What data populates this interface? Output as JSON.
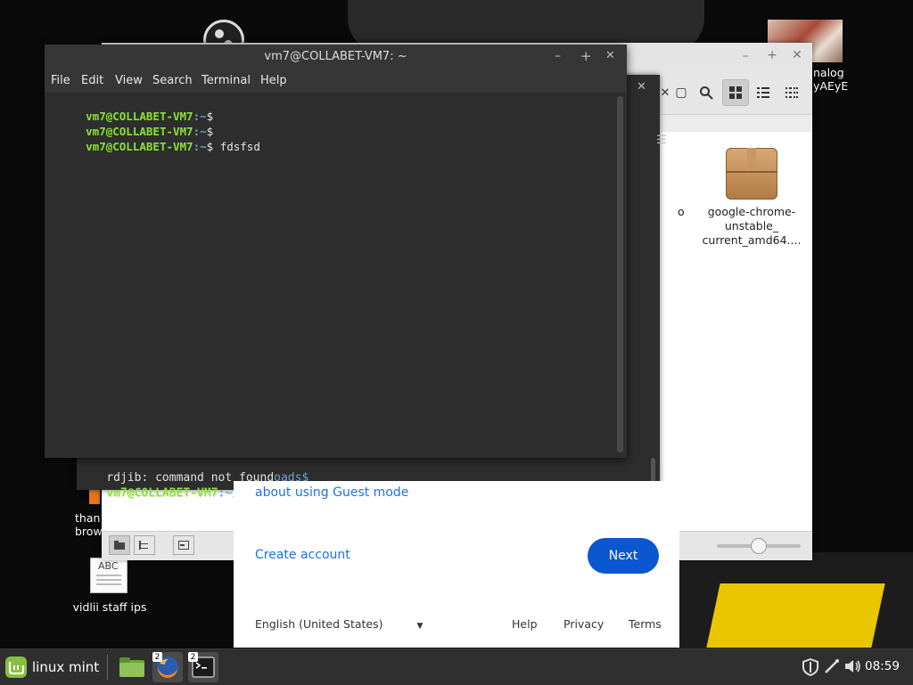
{
  "desktop": {
    "icons": [
      {
        "label_line1": "nalog",
        "label_line2": "yAEyE"
      },
      {
        "label_line1": "than",
        "label_line2": "browse"
      },
      {
        "label": "vidlii staff ips",
        "doc_text": "ABC"
      }
    ]
  },
  "file_manager": {
    "file": {
      "line1": "google-chrome-",
      "line2": "unstable_",
      "line3": "current_amd64...."
    },
    "partial_label": "o"
  },
  "terminal_back": {
    "lines": [
      {
        "text": "rdjib: command not found",
        "tail": "oads$"
      },
      {
        "user": "vm7@COLLABET-VM7",
        "path": ":~/Downloads",
        "suffix": "$ "
      }
    ]
  },
  "google_dialog": {
    "guest_link": "about using Guest mode",
    "create_account": "Create account",
    "next": "Next",
    "language": "English (United States)",
    "help": "Help",
    "privacy": "Privacy",
    "terms": "Terms"
  },
  "terminal": {
    "title": "vm7@COLLABET-VM7: ~",
    "menu": [
      "File",
      "Edit",
      "View",
      "Search",
      "Terminal",
      "Help"
    ],
    "lines": [
      {
        "user": "vm7@COLLABET-VM7",
        "path": ":~",
        "suffix": "$"
      },
      {
        "user": "vm7@COLLABET-VM7",
        "path": ":~",
        "suffix": "$"
      },
      {
        "user": "vm7@COLLABET-VM7",
        "path": ":~",
        "suffix": "$ fdsfsd"
      }
    ]
  },
  "taskbar": {
    "menu_label": "linux mint",
    "firefox_badge": "2",
    "terminal_badge": "2",
    "clock": "08:59"
  },
  "colors": {
    "prompt_user": "#8ae234",
    "prompt_path": "#729fcf",
    "google_blue": "#0b57d0"
  }
}
